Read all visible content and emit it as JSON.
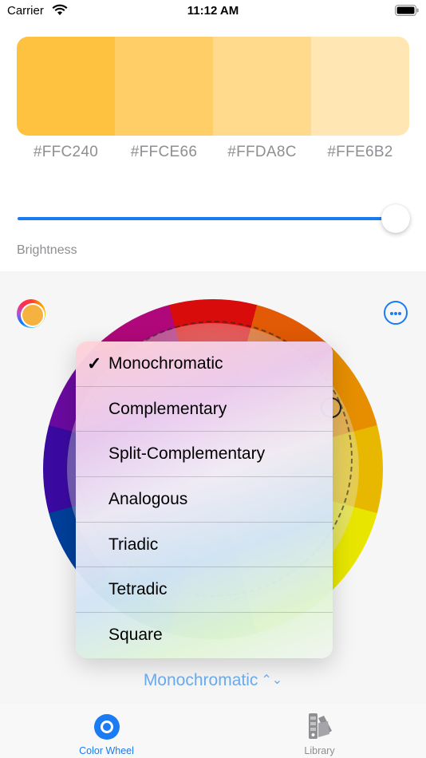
{
  "status_bar": {
    "carrier": "Carrier",
    "time": "11:12 AM"
  },
  "palette": {
    "swatches": [
      {
        "hex": "#FFC240",
        "color": "#FFC240"
      },
      {
        "hex": "#FFCE66",
        "color": "#FFCE66"
      },
      {
        "hex": "#FFDA8C",
        "color": "#FFDA8C"
      },
      {
        "hex": "#FFE6B2",
        "color": "#FFE6B2"
      }
    ]
  },
  "brightness": {
    "label": "Brightness",
    "value": 1.0
  },
  "scheme_menu": {
    "items": [
      {
        "label": "Monochromatic",
        "checked": true
      },
      {
        "label": "Complementary",
        "checked": false
      },
      {
        "label": "Split-Complementary",
        "checked": false
      },
      {
        "label": "Analogous",
        "checked": false
      },
      {
        "label": "Triadic",
        "checked": false
      },
      {
        "label": "Tetradic",
        "checked": false
      },
      {
        "label": "Square",
        "checked": false
      }
    ],
    "selected": "Monochromatic"
  },
  "tab_bar": {
    "tabs": [
      {
        "label": "Color Wheel",
        "icon": "color-wheel-icon",
        "active": true
      },
      {
        "label": "Library",
        "icon": "library-icon",
        "active": false
      }
    ]
  },
  "colors": {
    "accent": "#1A7BF2",
    "selected_color": "#F5B240"
  }
}
